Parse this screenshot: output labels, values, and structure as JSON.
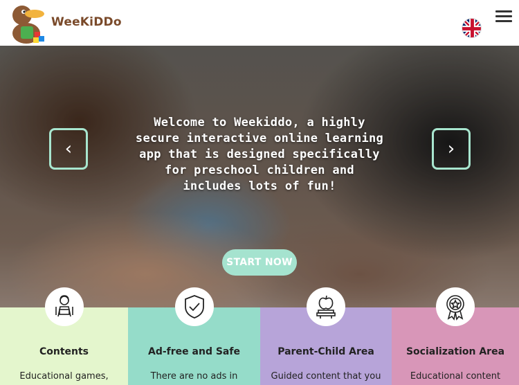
{
  "header": {
    "logo_text": "WeeKiDDo",
    "language": "English",
    "menu": "menu"
  },
  "hero": {
    "headline": "Welcome to Weekiddo, a highly secure interactive online learning app that is designed specifically for preschool children and includes lots of fun!",
    "prev": "‹",
    "next": "›",
    "cta": "START NOW"
  },
  "features": [
    {
      "title": "Contents",
      "desc": "Educational games,",
      "color": "#e4f6cd",
      "icon": "reading-child-icon"
    },
    {
      "title": "Ad-free and Safe",
      "desc": "There are no ads in",
      "color": "#95dcc9",
      "icon": "shield-check-icon"
    },
    {
      "title": "Parent-Child Area",
      "desc": "Guided content that you",
      "color": "#b7a4d9",
      "icon": "apple-on-books-icon"
    },
    {
      "title": "Socialization Area",
      "desc": "Educational content",
      "color": "#d896b8",
      "icon": "award-badge-icon"
    }
  ]
}
